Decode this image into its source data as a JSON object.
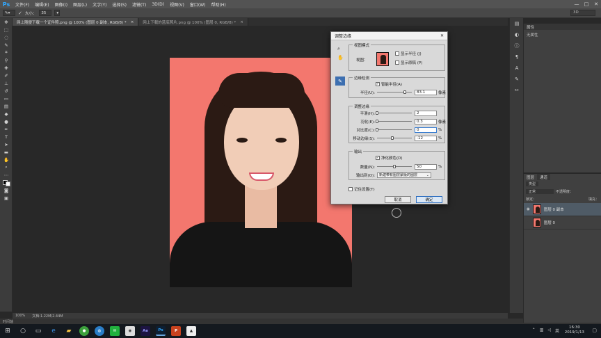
{
  "app": {
    "logo": "Ps",
    "menu": [
      "文件(F)",
      "编辑(E)",
      "图像(I)",
      "图层(L)",
      "文字(Y)",
      "选择(S)",
      "滤镜(T)",
      "3D(D)",
      "视图(V)",
      "窗口(W)",
      "帮助(H)"
    ],
    "window_controls": [
      "—",
      "□",
      "✕"
    ]
  },
  "options_bar": {
    "size_label": "大小：",
    "size_value": "35",
    "workspace": "3D"
  },
  "doc_tabs": [
    {
      "label": "网上随便下载一个证件照.png @ 100% (图层 0 副本, RGB/8) *",
      "active": true
    },
    {
      "label": "网上下载的蓝底照片.png @ 100% (图层 0, RGB/8) *",
      "active": false
    }
  ],
  "status": {
    "zoom": "100%",
    "doc_info": "文档:1.22M/2.44M",
    "timeline": "时间轴"
  },
  "properties_panel": {
    "tab": "属性",
    "body": "无属性"
  },
  "layers_panel": {
    "tabs": [
      "图层",
      "通道"
    ],
    "kind": "类型",
    "blend": "正常",
    "opacity_label": "不透明度：",
    "lock_label": "锁定：",
    "fill_label": "填充：",
    "layers": [
      {
        "name": "图层 0 副本",
        "selected": true
      },
      {
        "name": "图层 0",
        "selected": false
      }
    ]
  },
  "dialog": {
    "title": "调整边缘",
    "view_mode": {
      "legend": "视图模式",
      "view_label": "视图：",
      "show_radius": "显示半径 (J)",
      "show_original": "显示原稿 (P)"
    },
    "edge_detection": {
      "legend": "边缘检测",
      "smart_radius": "智能半径(A)",
      "radius_label": "半径(U):",
      "radius_value": "83.1",
      "radius_unit": "像素",
      "radius_pos": 0.8
    },
    "adjust_edge": {
      "legend": "调整边缘",
      "rows": [
        {
          "label": "平滑(H):",
          "value": "2",
          "unit": "",
          "pos": 0.0
        },
        {
          "label": "羽化(E):",
          "value": "0.3",
          "unit": "像素",
          "pos": 0.0
        },
        {
          "label": "对比度(C):",
          "value": "0",
          "unit": "%",
          "pos": 0.0
        },
        {
          "label": "移动边缘(S):",
          "value": "-12",
          "unit": "%",
          "pos": 0.44
        }
      ]
    },
    "output": {
      "legend": "输出",
      "decontaminate": "净化颜色(D)",
      "amount_label": "数量(N):",
      "amount_value": "50",
      "amount_unit": "%",
      "amount_pos": 0.5,
      "output_to_label": "输出到(O):",
      "output_to_value": "新建带有图层蒙版的图层"
    },
    "remember": "记住设置(T)",
    "cancel": "取消",
    "ok": "确定"
  },
  "taskbar": {
    "time": "16:30",
    "date": "2019/1/13"
  }
}
